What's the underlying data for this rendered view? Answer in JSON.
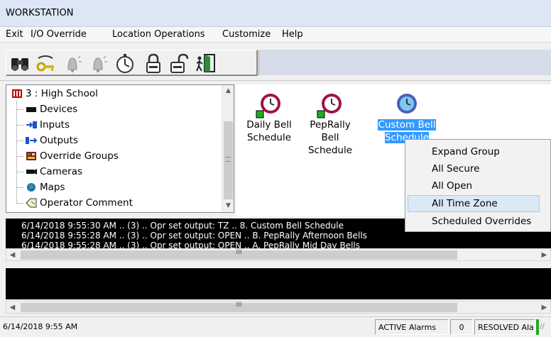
{
  "window": {
    "title": "WORKSTATION"
  },
  "menu": [
    "Exit",
    "I/O Override",
    "Location Operations",
    "Customize",
    "Help"
  ],
  "toolbar": {
    "buttons": [
      "binoculars-icon",
      "key-icon",
      "alarm-bell-icon",
      "alarm-bell-2-icon",
      "stopwatch-icon",
      "lock-closed-icon",
      "lock-open-icon",
      "exit-door-icon"
    ]
  },
  "tree": {
    "root": "3 : High School",
    "items": [
      "Devices",
      "Inputs",
      "Outputs",
      "Override Groups",
      "Cameras",
      "Maps",
      "Operator Comment"
    ]
  },
  "bells": [
    {
      "label1": "Daily Bell",
      "label2": "Schedule"
    },
    {
      "label1": "PepRally Bell",
      "label2": "Schedule"
    },
    {
      "label1": "Custom Bell",
      "label2": "Schedule"
    }
  ],
  "context_menu": {
    "items": [
      "Expand Group",
      "All Secure",
      "All Open",
      "All Time Zone",
      "Scheduled Overrides"
    ],
    "highlighted": "All Time Zone"
  },
  "log": [
    "6/14/2018 9:55:30 AM .. (3) .. Opr set output: TZ .. 8. Custom Bell Schedule",
    "6/14/2018 9:55:28 AM .. (3) .. Opr set output: OPEN .. B. PepRally Afternoon Bells",
    "6/14/2018 9:55:28 AM .. (3) .. Opr set output: OPEN .. A. PepRally Mid Day Bells"
  ],
  "status": {
    "datetime": "6/14/2018 9:55 AM",
    "active_label": "ACTIVE Alarms",
    "active_count": "0",
    "resolved_label": "RESOLVED Ala"
  },
  "colors": {
    "selection": "#3399ff",
    "menu_highlight": "#dbe8f5",
    "log_bg": "#000000",
    "bell_ring": "#a0134a"
  }
}
